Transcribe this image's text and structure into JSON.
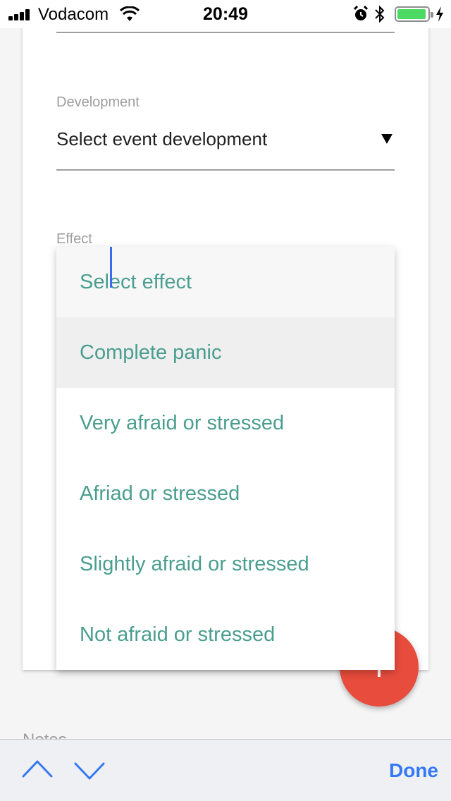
{
  "status_bar": {
    "carrier": "Vodacom",
    "time": "20:49",
    "signal_bars": 4,
    "battery_color": "#4cd964"
  },
  "form": {
    "development": {
      "label": "Development",
      "value": "Select event development"
    },
    "effect": {
      "label": "Effect",
      "options": [
        "Select effect",
        "Complete panic",
        "Very afraid or stressed",
        "Afriad or stressed",
        "Slightly afraid or stressed",
        "Not afraid or stressed"
      ],
      "highlighted_option": "Complete panic"
    },
    "notes_label": "Notes"
  },
  "fab": {
    "icon": "plus-icon",
    "color": "#e84c3d"
  },
  "keyboard_accessory": {
    "up_icon": "chevron-up-icon",
    "down_icon": "chevron-down-icon",
    "done_label": "Done",
    "accent_color": "#3478f6"
  },
  "colors": {
    "option_text": "#4a9e8f",
    "label_text": "#9e9e9e",
    "caret": "#3a6cf0"
  }
}
